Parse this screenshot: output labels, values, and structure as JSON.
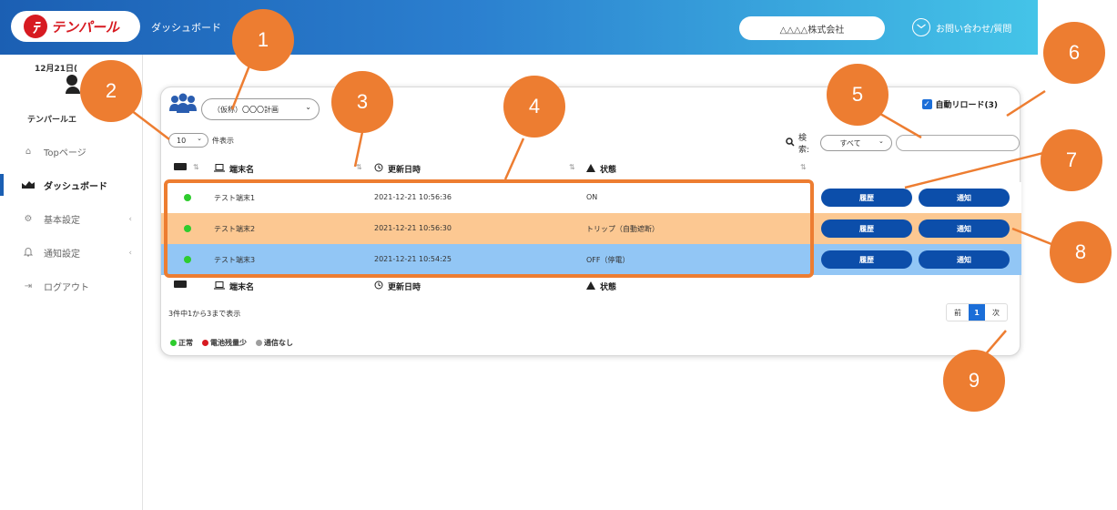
{
  "header": {
    "logo_mark": "ﾃ",
    "logo_text": "テンパール",
    "title": "ダッシュボード",
    "company": "△△△△株式会社",
    "contact": "お問い合わせ/質問"
  },
  "sidebar": {
    "date": "12月21日(",
    "user_name": "テンパールエ",
    "items": [
      {
        "label": "Topページ",
        "icon": "home-icon"
      },
      {
        "label": "ダッシュボード",
        "icon": "chart-icon"
      },
      {
        "label": "基本設定",
        "icon": "gear-icon"
      },
      {
        "label": "通知設定",
        "icon": "bell-icon"
      },
      {
        "label": "ログアウト",
        "icon": "logout-icon"
      }
    ]
  },
  "card": {
    "project": "（仮称）〇〇〇計画",
    "page_size": "10",
    "page_size_suffix": "件表示",
    "auto_reload": "自動リロード(3)",
    "search_label": "検索:",
    "search_category": "すべて",
    "columns": {
      "name": "端末名",
      "updated": "更新日時",
      "status": "状態"
    },
    "rows": [
      {
        "name": "テスト端末1",
        "updated": "2021-12-21 10:56:36",
        "status": "ON",
        "history": "履歴",
        "notify": "通知"
      },
      {
        "name": "テスト端末2",
        "updated": "2021-12-21 10:56:30",
        "status": "トリップ（自動遮断）",
        "history": "履歴",
        "notify": "通知"
      },
      {
        "name": "テスト端末3",
        "updated": "2021-12-21 10:54:25",
        "status": "OFF（停電）",
        "history": "履歴",
        "notify": "通知"
      }
    ],
    "summary": "3件中1から3まで表示",
    "pager": {
      "prev": "前",
      "current": "1",
      "next": "次"
    },
    "legend": [
      {
        "label": "正常",
        "color": "#2ecc2e"
      },
      {
        "label": "電池残量少",
        "color": "#d71a21"
      },
      {
        "label": "通信なし",
        "color": "#9e9e9e"
      }
    ]
  },
  "callouts": [
    "1",
    "2",
    "3",
    "4",
    "5",
    "6",
    "7",
    "8",
    "9"
  ],
  "colors": {
    "accent": "#ed7d31",
    "primary_button": "#0c4eaa",
    "row_trip": "#fcc892",
    "row_off": "#92c6f5"
  }
}
